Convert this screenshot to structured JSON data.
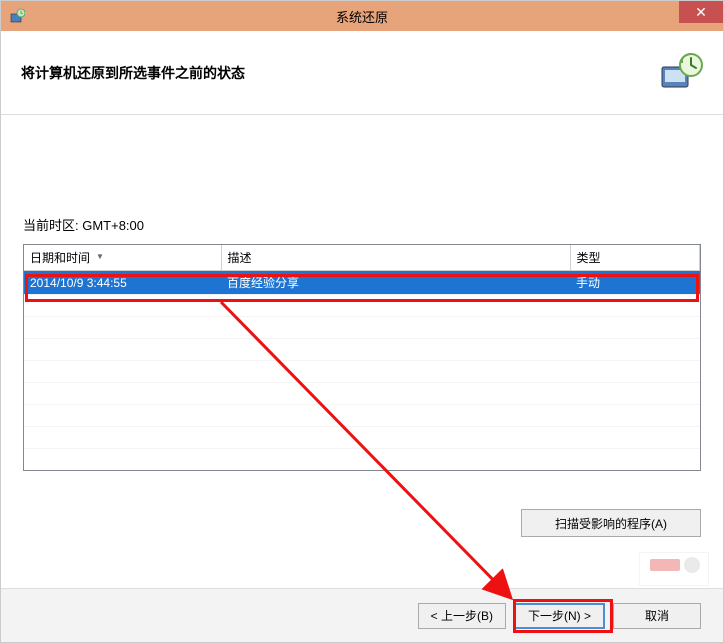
{
  "window": {
    "title": "系统还原"
  },
  "header": {
    "subtitle": "将计算机还原到所选事件之前的状态"
  },
  "content": {
    "timezone_label": "当前时区: GMT+8:00"
  },
  "table": {
    "columns": {
      "datetime": "日期和时间",
      "desc": "描述",
      "type": "类型"
    },
    "rows": [
      {
        "datetime": "2014/10/9 3:44:55",
        "desc": "百度经验分享",
        "type": "手动"
      }
    ]
  },
  "buttons": {
    "scan": "扫描受影响的程序(A)",
    "back": "< 上一步(B)",
    "next": "下一步(N) >",
    "cancel": "取消"
  },
  "icons": {
    "system": "restore-icon",
    "close": "✕"
  }
}
